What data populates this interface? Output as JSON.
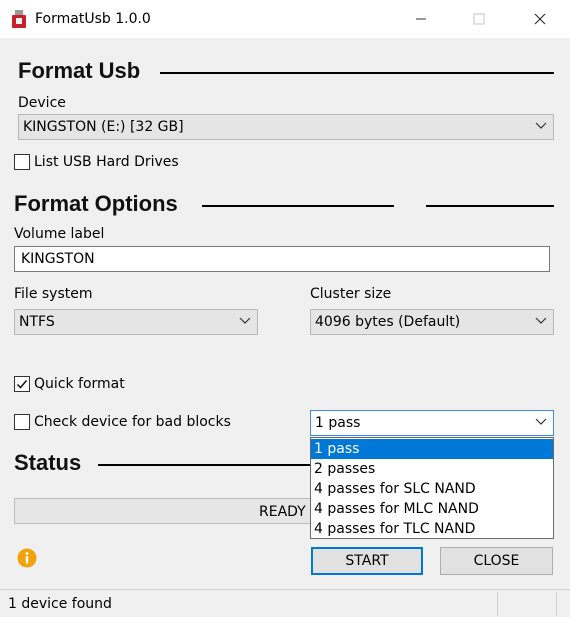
{
  "window": {
    "title": "FormatUsb 1.0.0",
    "minimize_glyph": "—",
    "maximize_glyph": "☐",
    "close_glyph": "✕"
  },
  "format_usb": {
    "heading": "Format Usb",
    "device_label": "Device",
    "device_value": "KINGSTON (E:) [32 GB]",
    "list_usb_label": "List USB Hard Drives",
    "list_usb_checked": false
  },
  "format_options": {
    "heading": "Format Options",
    "volume_label_caption": "Volume label",
    "volume_label_value": "KINGSTON",
    "file_system_label": "File system",
    "file_system_value": "NTFS",
    "cluster_size_label": "Cluster size",
    "cluster_size_value": "4096 bytes (Default)",
    "quick_format_label": "Quick format",
    "quick_format_checked": true,
    "bad_blocks_label": "Check device for bad blocks",
    "bad_blocks_checked": false,
    "passes_value": "1 pass",
    "passes_options": [
      "1 pass",
      "2 passes",
      "4 passes for SLC NAND",
      "4 passes for MLC NAND",
      "4 passes for TLC NAND"
    ]
  },
  "status": {
    "heading": "Status",
    "progress_text": "READY",
    "start_label": "START",
    "close_label": "CLOSE",
    "info_icon": "info-icon"
  },
  "statusbar": {
    "text": "1 device found"
  },
  "colors": {
    "selection": "#0078d7",
    "info": "#f0a30a"
  }
}
